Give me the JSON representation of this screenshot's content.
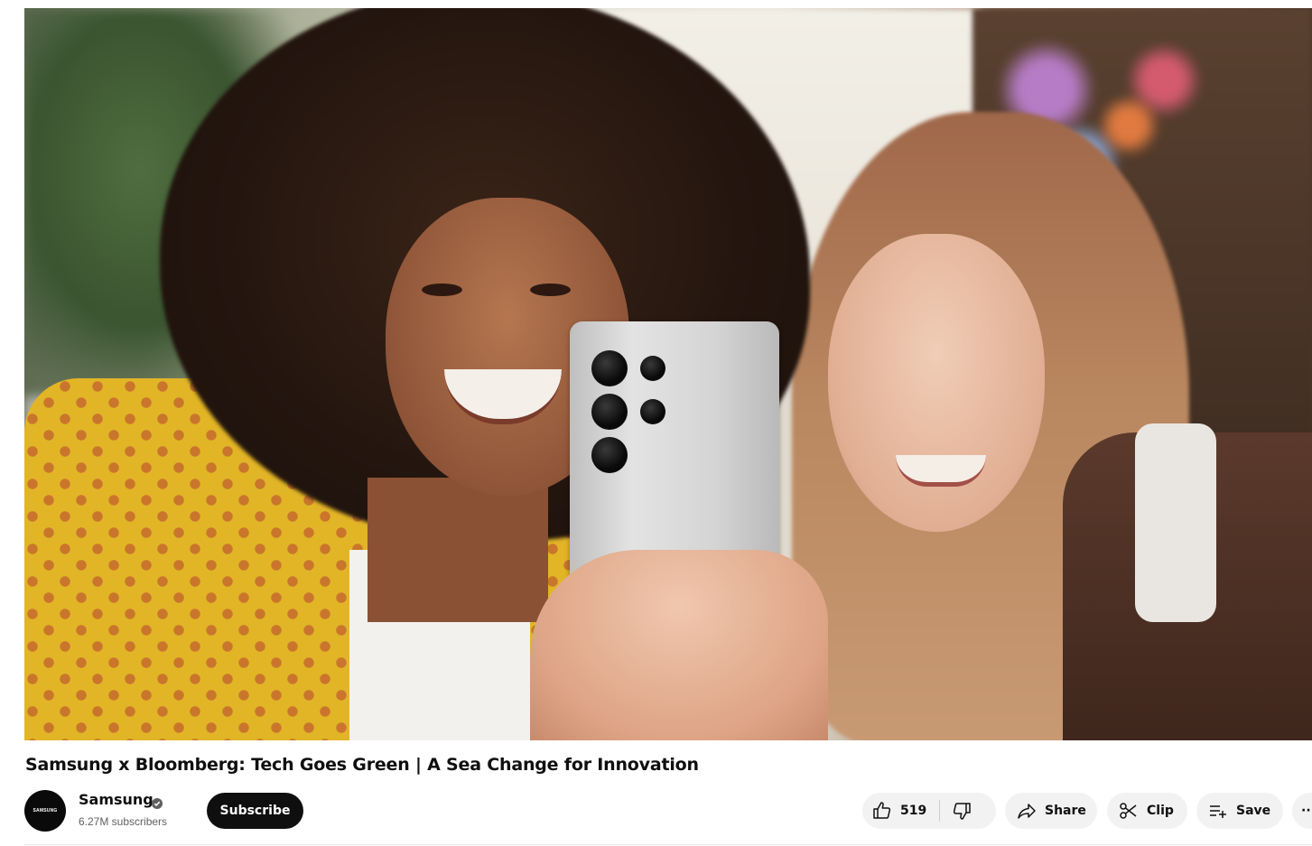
{
  "video": {
    "title": "Samsung x Bloomberg: Tech Goes Green | A Sea Change for Innovation"
  },
  "channel": {
    "name": "Samsung",
    "subscribers": "6.27M subscribers",
    "avatar_text": "SAMSUNG",
    "verified_icon": "verified-check-icon"
  },
  "actions": {
    "subscribe_label": "Subscribe",
    "like_count": "519",
    "share_label": "Share",
    "clip_label": "Clip",
    "save_label": "Save",
    "more_label": "···"
  },
  "icons": {
    "like": "thumbs-up-icon",
    "dislike": "thumbs-down-icon",
    "share": "share-arrow-icon",
    "clip": "scissors-icon",
    "save": "playlist-add-icon",
    "more": "more-horizontal-icon"
  },
  "colors": {
    "subscribe_bg": "#0f0f0f",
    "pill_bg": "#f2f2f2",
    "text_primary": "#0f0f0f",
    "text_secondary": "#606060"
  }
}
